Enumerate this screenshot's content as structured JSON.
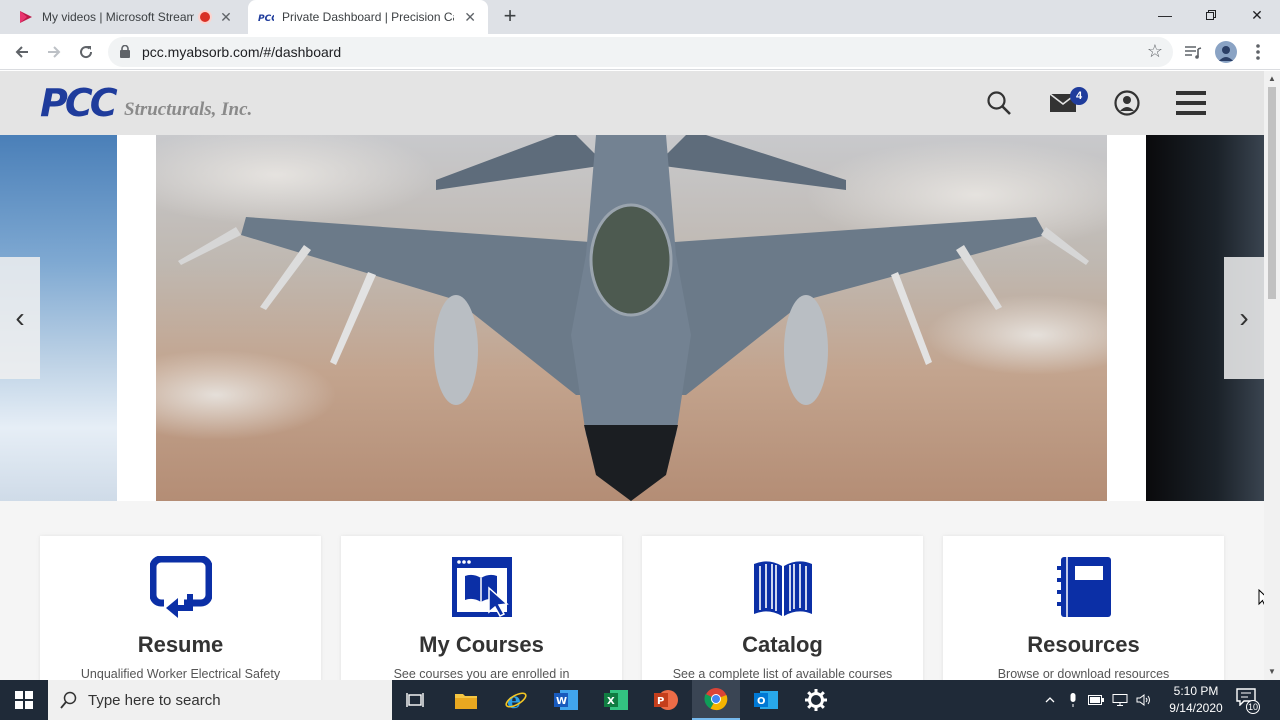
{
  "browser": {
    "tabs": [
      {
        "title": "My videos | Microsoft Stream",
        "recording": true
      },
      {
        "title": "Private Dashboard | Precision Castparts",
        "active": true
      }
    ],
    "url": "pcc.myabsorb.com/#/dashboard"
  },
  "site": {
    "logo_mark": "PCC",
    "logo_company": "Structurals, Inc.",
    "message_count": "4",
    "icons": [
      "search-icon",
      "mail-icon",
      "account-icon",
      "hamburger-menu-icon"
    ]
  },
  "carousel": {
    "prev_label": "‹",
    "next_label": "›"
  },
  "tiles": [
    {
      "name": "Resume",
      "description": "Unqualified Worker Electrical Safety",
      "icon": "resume-icon"
    },
    {
      "name": "My Courses",
      "description": "See courses you are enrolled in",
      "icon": "my-courses-icon"
    },
    {
      "name": "Catalog",
      "description": "See a complete list of available courses",
      "icon": "catalog-book-icon"
    },
    {
      "name": "Resources",
      "description": "Browse or download resources",
      "icon": "resources-notebook-icon"
    }
  ],
  "taskbar": {
    "search_placeholder": "Type here to search",
    "time": "5:10 PM",
    "date": "9/14/2020",
    "notification_count": "10"
  },
  "colors": {
    "brand_blue": "#1f3c9c",
    "tile_icon_blue": "#0b2fa6",
    "taskbar": "#1f2a38"
  }
}
